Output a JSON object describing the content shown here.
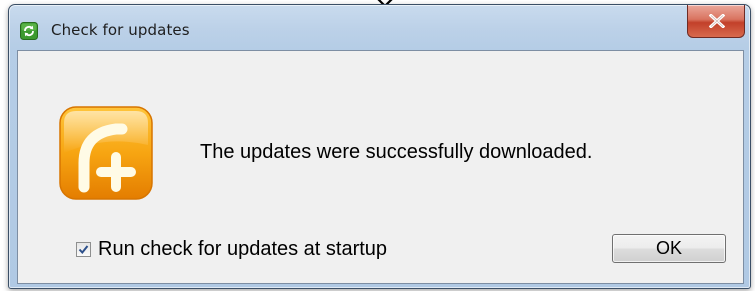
{
  "window": {
    "title": "Check for updates",
    "title_icon": "refresh-icon",
    "close_icon": "close-icon"
  },
  "dialog": {
    "app_icon": "app-logo-icon",
    "message": "The updates were successfully downloaded.",
    "startup_checkbox": {
      "label": "Run check for updates at startup",
      "checked": true
    },
    "ok_label": "OK"
  },
  "colors": {
    "titlebar": "#bcd1e8",
    "close_button": "#c2402a",
    "client_background": "#f0f0f0",
    "app_icon_orange": "#f29400"
  }
}
